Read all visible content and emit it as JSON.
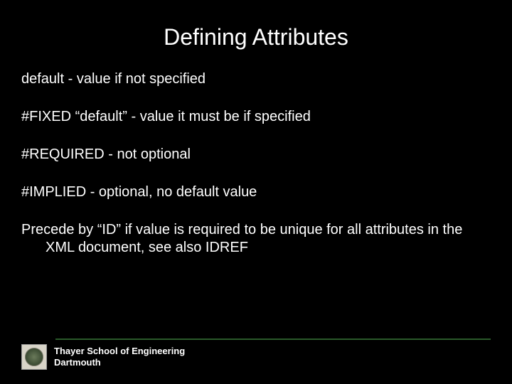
{
  "title": "Defining Attributes",
  "bullets": [
    "default - value if not specified",
    "#FIXED “default” - value it must be if specified",
    "#REQUIRED - not optional",
    "#IMPLIED - optional, no default value",
    "Precede by “ID” if value is required to be unique for all attributes in the XML document, see also IDREF"
  ],
  "footer": {
    "line1": "Thayer School of Engineering",
    "line2": "Dartmouth"
  }
}
